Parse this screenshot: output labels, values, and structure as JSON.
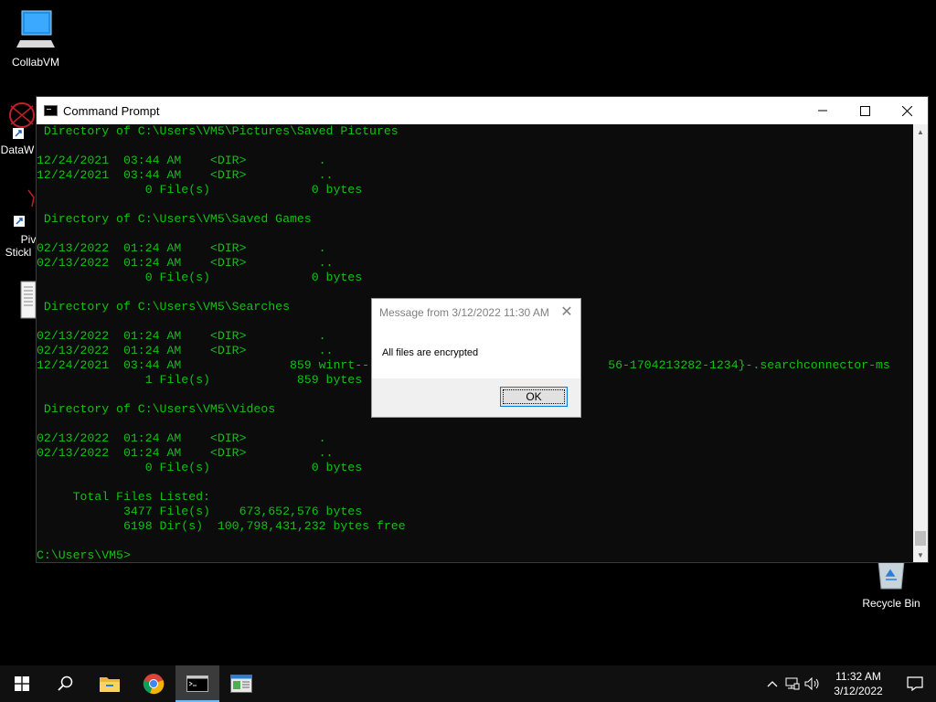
{
  "desktop": {
    "icons": [
      {
        "label": "CollabVM"
      },
      {
        "label": "DataW"
      },
      {
        "label": "Piv"
      },
      {
        "label": "Stickl"
      },
      {
        "label": "Recycle Bin"
      }
    ]
  },
  "cmd": {
    "title": "Command Prompt",
    "lines": [
      " Directory of C:\\Users\\VM5\\Pictures\\Saved Pictures",
      "",
      "12/24/2021  03:44 AM    <DIR>          .",
      "12/24/2021  03:44 AM    <DIR>          ..",
      "               0 File(s)              0 bytes",
      "",
      " Directory of C:\\Users\\VM5\\Saved Games",
      "",
      "02/13/2022  01:24 AM    <DIR>          .",
      "02/13/2022  01:24 AM    <DIR>          ..",
      "               0 File(s)              0 bytes",
      "",
      " Directory of C:\\Users\\VM5\\Searches",
      "",
      "02/13/2022  01:24 AM    <DIR>          .",
      "02/13/2022  01:24 AM    <DIR>          ..",
      "12/24/2021  03:44 AM               859 winrt--                                 56-1704213282-1234}-.searchconnector-ms",
      "               1 File(s)            859 bytes",
      "",
      " Directory of C:\\Users\\VM5\\Videos",
      "",
      "02/13/2022  01:24 AM    <DIR>          .",
      "02/13/2022  01:24 AM    <DIR>          ..",
      "               0 File(s)              0 bytes",
      "",
      "     Total Files Listed:",
      "            3477 File(s)    673,652,576 bytes",
      "            6198 Dir(s)  100,798,431,232 bytes free",
      "",
      "C:\\Users\\VM5>"
    ]
  },
  "dialog": {
    "title": "Message from  3/12/2022 11:30 AM",
    "message": "All files are encrypted",
    "ok_label": "OK"
  },
  "taskbar": {
    "time": "11:32 AM",
    "date": "3/12/2022"
  },
  "colors": {
    "console_text": "#13c013",
    "console_bg": "#0c0c0c",
    "taskbar_bg": "#101010",
    "accent": "#0078d7"
  }
}
